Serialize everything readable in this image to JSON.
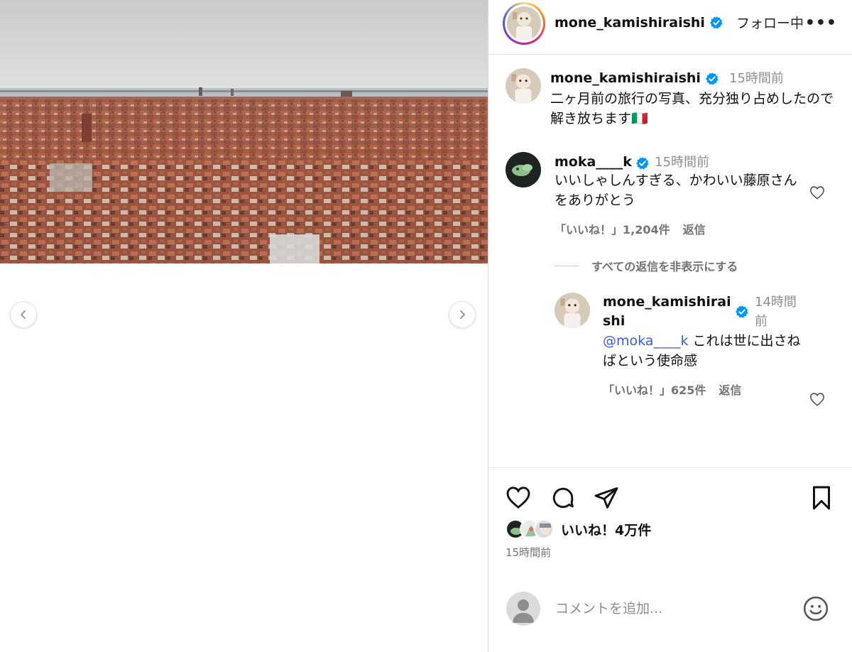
{
  "post": {
    "account": "mone_kamishiraishi",
    "follow_status": "フォロー中",
    "more_label": "•••"
  },
  "caption": {
    "username": "mone_kamishiraishi",
    "time": "15時間前",
    "text": "二ヶ月前の旅行の写真、充分独り占めしたので解き放ちます🇮🇹"
  },
  "comments": [
    {
      "username": "moka____k",
      "time": "15時間前",
      "text": "いいしゃしんすぎる、かわいい藤原さんをありがとう",
      "likes": "「いいね！」1,204件",
      "reply_label": "返信"
    }
  ],
  "hide_replies_label": "すべての返信を非表示にする",
  "reply": {
    "username_line1": "mone_kamishirai",
    "username_line2": "shi",
    "time_line1": "14時間",
    "time_line2": "前",
    "mention": "@moka____k",
    "text": "これは世に出さねばという使命感",
    "likes": "「いいね！」625件",
    "reply_label": "返信"
  },
  "stats": {
    "likes": "いいね！4万件",
    "posted": "15時間前"
  },
  "add_comment": {
    "placeholder": "コメントを追加..."
  },
  "colors": {
    "verified": "#0095f6",
    "muted": "#737373",
    "mention": "#3b5bdb"
  }
}
